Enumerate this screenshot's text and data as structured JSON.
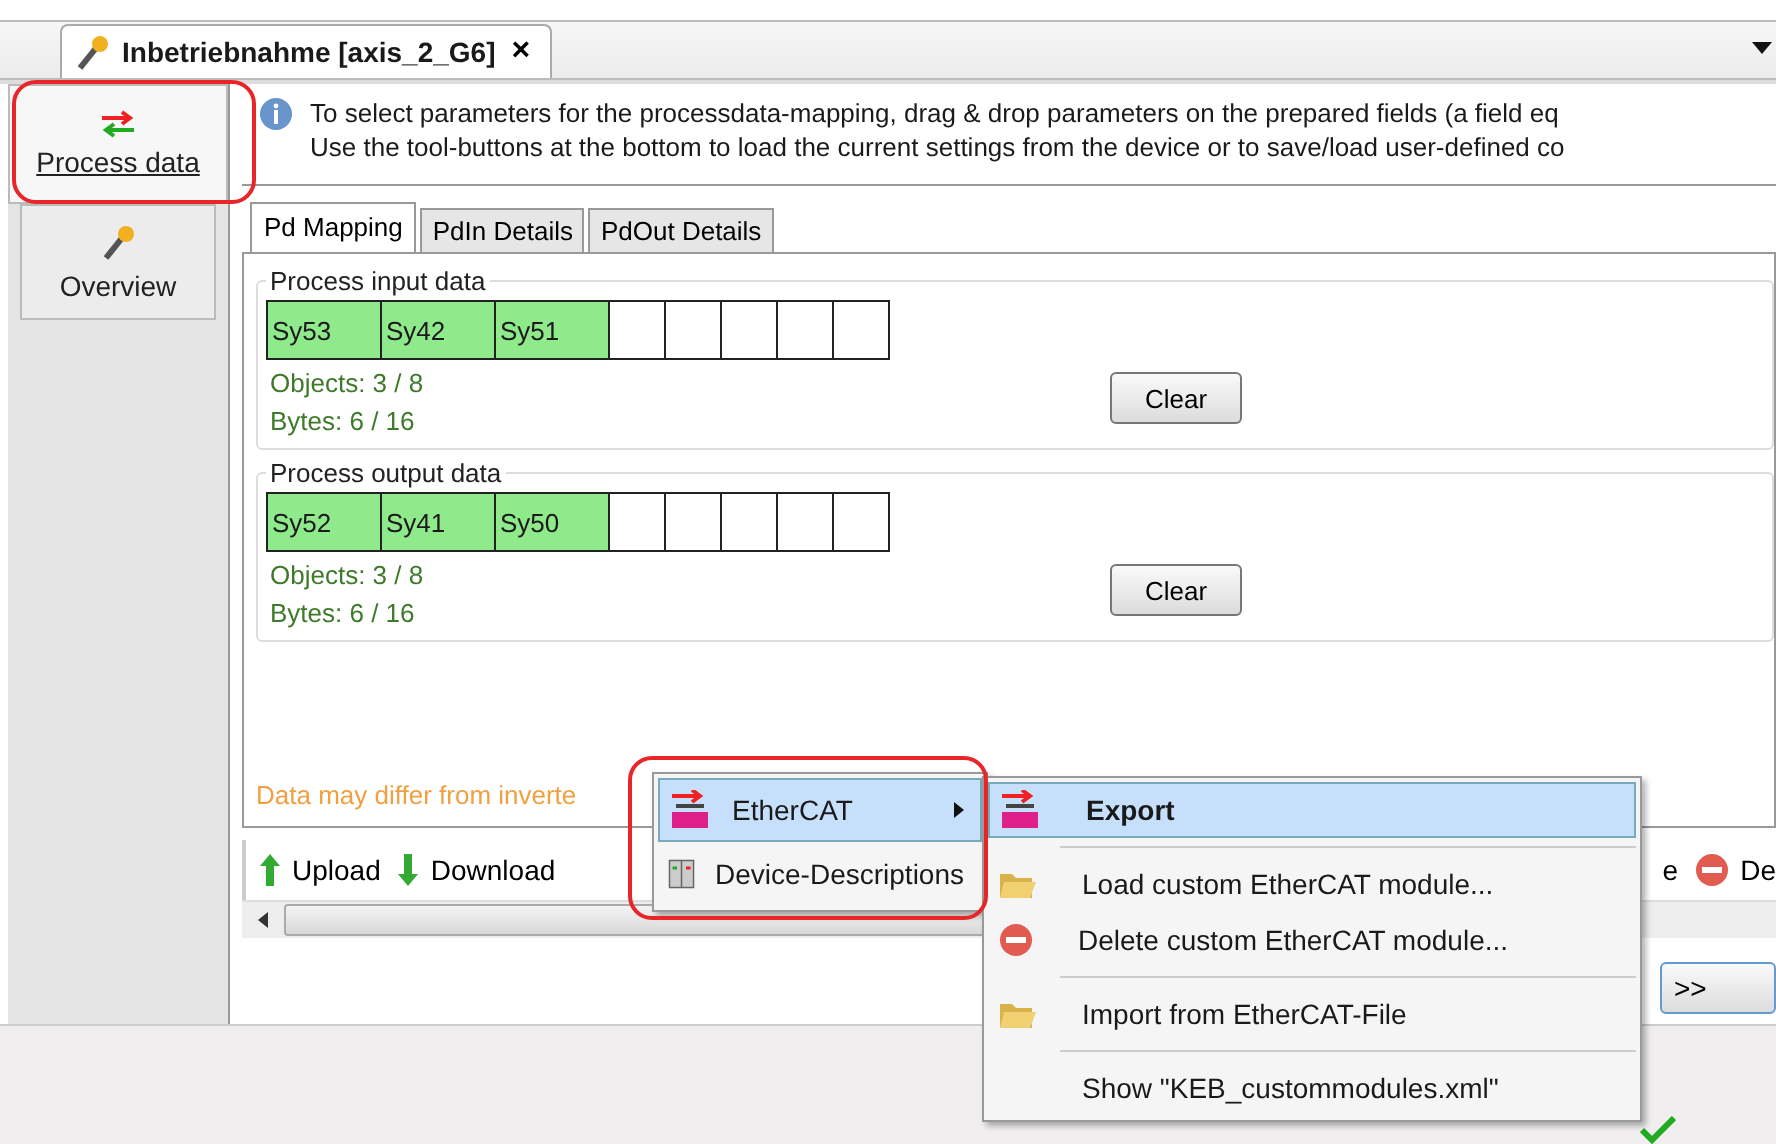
{
  "document_tab": {
    "title": "Inbetriebnahme [axis_2_G6]",
    "close": "×"
  },
  "sidebar": {
    "items": [
      {
        "label": "Process data",
        "selected": true,
        "kind": "process"
      },
      {
        "label": "Overview",
        "selected": false,
        "kind": "overview"
      }
    ]
  },
  "info": {
    "lines": [
      "To select parameters for the processdata-mapping, drag & drop parameters on the prepared fields (a field eq",
      "Use the tool-buttons at the bottom to load the current settings from the device or to save/load user-defined co"
    ]
  },
  "subtabs": [
    {
      "label": "Pd Mapping",
      "selected": true
    },
    {
      "label": "PdIn Details",
      "selected": false
    },
    {
      "label": "PdOut Details",
      "selected": false
    }
  ],
  "groups": [
    {
      "title": "Process input data",
      "slots": [
        {
          "label": "Sy53",
          "filled": true
        },
        {
          "label": "Sy42",
          "filled": true
        },
        {
          "label": "Sy51",
          "filled": true
        },
        {
          "filled": false
        },
        {
          "filled": false
        },
        {
          "filled": false
        },
        {
          "filled": false
        },
        {
          "filled": false
        }
      ],
      "objects": "Objects: 3 / 8",
      "bytes": "Bytes: 6 / 16",
      "button": "Clear"
    },
    {
      "title": "Process output data",
      "slots": [
        {
          "label": "Sy52",
          "filled": true
        },
        {
          "label": "Sy41",
          "filled": true
        },
        {
          "label": "Sy50",
          "filled": true
        },
        {
          "filled": false
        },
        {
          "filled": false
        },
        {
          "filled": false
        },
        {
          "filled": false
        },
        {
          "filled": false
        }
      ],
      "objects": "Objects: 3 / 8",
      "bytes": "Bytes: 6 / 16",
      "button": "Clear"
    }
  ],
  "warning": "Data may differ from inverte",
  "toolbar": {
    "items": [
      {
        "label": "Upload",
        "kind": "up"
      },
      {
        "label": "Download",
        "kind": "down"
      }
    ],
    "right_items": [
      {
        "label": "e",
        "kind": "plain"
      },
      {
        "label": "De",
        "kind": "delete"
      }
    ]
  },
  "next_button": ">>",
  "context_menu": {
    "items": [
      {
        "label": "EtherCAT",
        "selected": true,
        "kind": "ethercat"
      },
      {
        "label": "Device-Descriptions",
        "selected": false,
        "kind": "device"
      }
    ]
  },
  "submenu": {
    "items": [
      {
        "label": "Export",
        "selected": true,
        "kind": "ethercat"
      },
      {
        "kind": "separator"
      },
      {
        "label": "Load custom EtherCAT module...",
        "selected": false,
        "kind": "folder"
      },
      {
        "label": "Delete custom EtherCAT module...",
        "selected": false,
        "kind": "delete"
      },
      {
        "kind": "separator"
      },
      {
        "label": "Import from EtherCAT-File",
        "selected": false,
        "kind": "folder"
      },
      {
        "kind": "separator"
      },
      {
        "label": "Show \"KEB_custommodules.xml\"",
        "selected": false,
        "kind": "plain"
      }
    ]
  }
}
